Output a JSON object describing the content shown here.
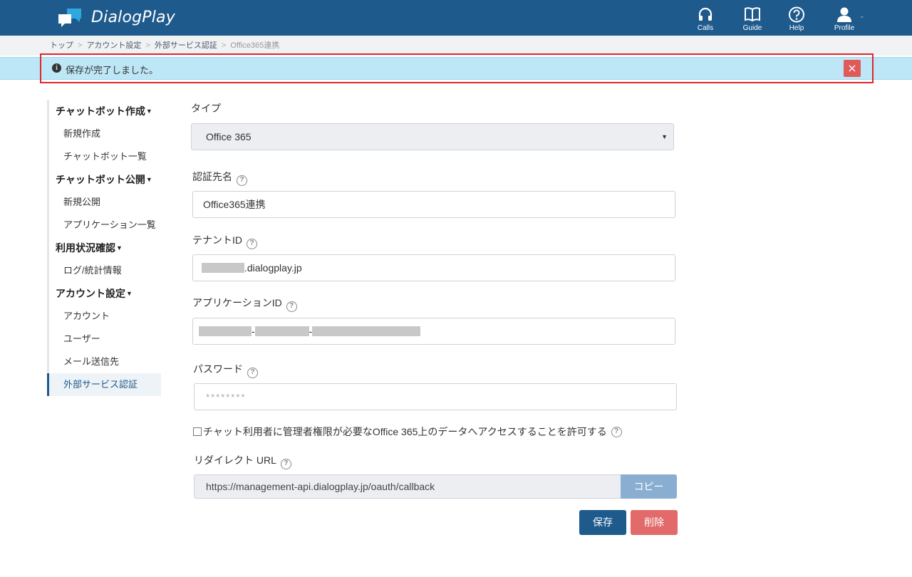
{
  "header": {
    "logo_text": "DialogPlay",
    "nav": [
      {
        "label": "Calls",
        "icon": "headset-icon"
      },
      {
        "label": "Guide",
        "icon": "book-icon"
      },
      {
        "label": "Help",
        "icon": "question-circle-icon"
      },
      {
        "label": "Profile",
        "icon": "user-icon"
      }
    ]
  },
  "breadcrumb": {
    "items": [
      "トップ",
      "アカウント設定",
      "外部サービス認証"
    ],
    "current": "Office365連携"
  },
  "alert": {
    "icon": "info-circle-icon",
    "message": "保存が完了しました。",
    "close": "×"
  },
  "sidebar": {
    "sections": [
      {
        "title": "チャットボット作成",
        "items": [
          "新規作成",
          "チャットボット一覧"
        ]
      },
      {
        "title": "チャットボット公開",
        "items": [
          "新規公開",
          "アプリケーション一覧"
        ]
      },
      {
        "title": "利用状況確認",
        "items": [
          "ログ/統計情報"
        ]
      },
      {
        "title": "アカウント設定",
        "items": [
          "アカウント",
          "ユーザー",
          "メール送信先",
          "外部サービス認証"
        ]
      }
    ],
    "active": "外部サービス認証"
  },
  "form": {
    "type_label": "タイプ",
    "type_value": "Office 365",
    "auth_name_label": "認証先名",
    "auth_name_value": "Office365連携",
    "tenant_label": "テナントID",
    "tenant_suffix": ".dialogplay.jp",
    "app_id_label": "アプリケーションID",
    "password_label": "パスワード",
    "password_placeholder": "********",
    "checkbox_label": "チャット利用者に管理者権限が必要なOffice 365上のデータへアクセスすることを許可する",
    "redirect_label": "リダイレクト URL",
    "redirect_url": "https://management-api.dialogplay.jp/oauth/callback",
    "copy_label": "コピー",
    "save_label": "保存",
    "delete_label": "削除"
  },
  "colors": {
    "brand": "#1e5a8c",
    "alert_bg": "#bde7f6",
    "danger": "#e36a6a",
    "copy": "#8aaed1"
  }
}
